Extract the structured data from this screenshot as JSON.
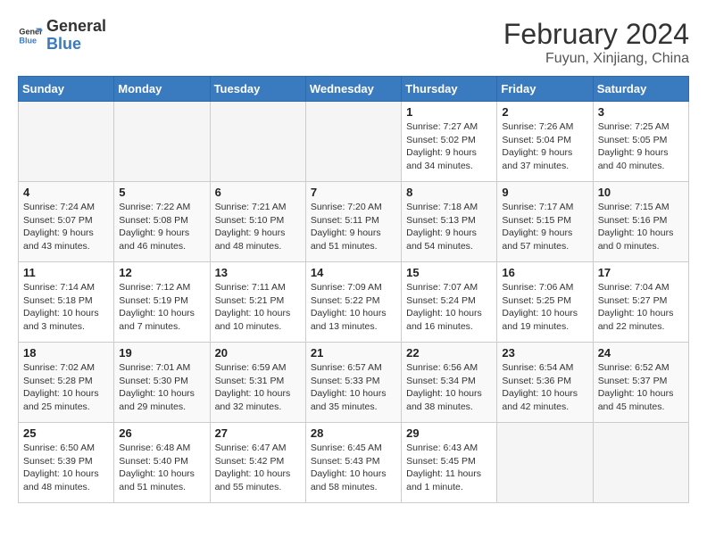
{
  "header": {
    "logo_line1": "General",
    "logo_line2": "Blue",
    "month_year": "February 2024",
    "location": "Fuyun, Xinjiang, China"
  },
  "days_of_week": [
    "Sunday",
    "Monday",
    "Tuesday",
    "Wednesday",
    "Thursday",
    "Friday",
    "Saturday"
  ],
  "weeks": [
    [
      {
        "day": "",
        "info": ""
      },
      {
        "day": "",
        "info": ""
      },
      {
        "day": "",
        "info": ""
      },
      {
        "day": "",
        "info": ""
      },
      {
        "day": "1",
        "info": "Sunrise: 7:27 AM\nSunset: 5:02 PM\nDaylight: 9 hours\nand 34 minutes."
      },
      {
        "day": "2",
        "info": "Sunrise: 7:26 AM\nSunset: 5:04 PM\nDaylight: 9 hours\nand 37 minutes."
      },
      {
        "day": "3",
        "info": "Sunrise: 7:25 AM\nSunset: 5:05 PM\nDaylight: 9 hours\nand 40 minutes."
      }
    ],
    [
      {
        "day": "4",
        "info": "Sunrise: 7:24 AM\nSunset: 5:07 PM\nDaylight: 9 hours\nand 43 minutes."
      },
      {
        "day": "5",
        "info": "Sunrise: 7:22 AM\nSunset: 5:08 PM\nDaylight: 9 hours\nand 46 minutes."
      },
      {
        "day": "6",
        "info": "Sunrise: 7:21 AM\nSunset: 5:10 PM\nDaylight: 9 hours\nand 48 minutes."
      },
      {
        "day": "7",
        "info": "Sunrise: 7:20 AM\nSunset: 5:11 PM\nDaylight: 9 hours\nand 51 minutes."
      },
      {
        "day": "8",
        "info": "Sunrise: 7:18 AM\nSunset: 5:13 PM\nDaylight: 9 hours\nand 54 minutes."
      },
      {
        "day": "9",
        "info": "Sunrise: 7:17 AM\nSunset: 5:15 PM\nDaylight: 9 hours\nand 57 minutes."
      },
      {
        "day": "10",
        "info": "Sunrise: 7:15 AM\nSunset: 5:16 PM\nDaylight: 10 hours\nand 0 minutes."
      }
    ],
    [
      {
        "day": "11",
        "info": "Sunrise: 7:14 AM\nSunset: 5:18 PM\nDaylight: 10 hours\nand 3 minutes."
      },
      {
        "day": "12",
        "info": "Sunrise: 7:12 AM\nSunset: 5:19 PM\nDaylight: 10 hours\nand 7 minutes."
      },
      {
        "day": "13",
        "info": "Sunrise: 7:11 AM\nSunset: 5:21 PM\nDaylight: 10 hours\nand 10 minutes."
      },
      {
        "day": "14",
        "info": "Sunrise: 7:09 AM\nSunset: 5:22 PM\nDaylight: 10 hours\nand 13 minutes."
      },
      {
        "day": "15",
        "info": "Sunrise: 7:07 AM\nSunset: 5:24 PM\nDaylight: 10 hours\nand 16 minutes."
      },
      {
        "day": "16",
        "info": "Sunrise: 7:06 AM\nSunset: 5:25 PM\nDaylight: 10 hours\nand 19 minutes."
      },
      {
        "day": "17",
        "info": "Sunrise: 7:04 AM\nSunset: 5:27 PM\nDaylight: 10 hours\nand 22 minutes."
      }
    ],
    [
      {
        "day": "18",
        "info": "Sunrise: 7:02 AM\nSunset: 5:28 PM\nDaylight: 10 hours\nand 25 minutes."
      },
      {
        "day": "19",
        "info": "Sunrise: 7:01 AM\nSunset: 5:30 PM\nDaylight: 10 hours\nand 29 minutes."
      },
      {
        "day": "20",
        "info": "Sunrise: 6:59 AM\nSunset: 5:31 PM\nDaylight: 10 hours\nand 32 minutes."
      },
      {
        "day": "21",
        "info": "Sunrise: 6:57 AM\nSunset: 5:33 PM\nDaylight: 10 hours\nand 35 minutes."
      },
      {
        "day": "22",
        "info": "Sunrise: 6:56 AM\nSunset: 5:34 PM\nDaylight: 10 hours\nand 38 minutes."
      },
      {
        "day": "23",
        "info": "Sunrise: 6:54 AM\nSunset: 5:36 PM\nDaylight: 10 hours\nand 42 minutes."
      },
      {
        "day": "24",
        "info": "Sunrise: 6:52 AM\nSunset: 5:37 PM\nDaylight: 10 hours\nand 45 minutes."
      }
    ],
    [
      {
        "day": "25",
        "info": "Sunrise: 6:50 AM\nSunset: 5:39 PM\nDaylight: 10 hours\nand 48 minutes."
      },
      {
        "day": "26",
        "info": "Sunrise: 6:48 AM\nSunset: 5:40 PM\nDaylight: 10 hours\nand 51 minutes."
      },
      {
        "day": "27",
        "info": "Sunrise: 6:47 AM\nSunset: 5:42 PM\nDaylight: 10 hours\nand 55 minutes."
      },
      {
        "day": "28",
        "info": "Sunrise: 6:45 AM\nSunset: 5:43 PM\nDaylight: 10 hours\nand 58 minutes."
      },
      {
        "day": "29",
        "info": "Sunrise: 6:43 AM\nSunset: 5:45 PM\nDaylight: 11 hours\nand 1 minute."
      },
      {
        "day": "",
        "info": ""
      },
      {
        "day": "",
        "info": ""
      }
    ]
  ]
}
